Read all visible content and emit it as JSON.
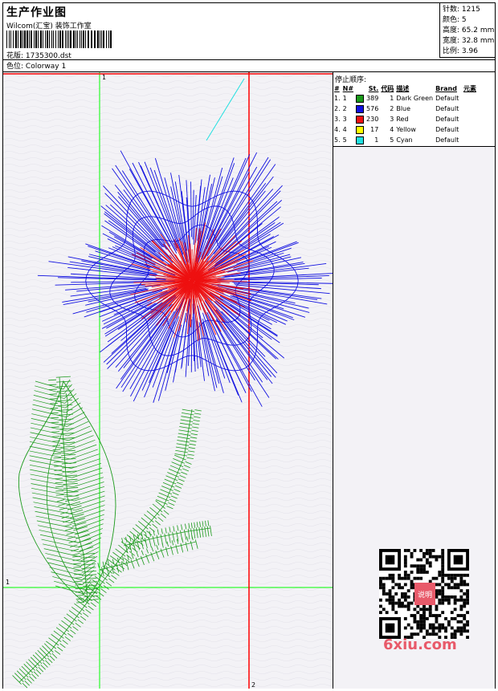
{
  "header": {
    "title": "生产作业图",
    "company": "Wilcom(汇宝) 装饰工作室",
    "design_label": "花版:",
    "design_value": "1735300.dst",
    "colorway_label": "色位:",
    "colorway_value": "Colorway 1"
  },
  "stats": {
    "stitches_label": "针数:",
    "stitches_value": "1215",
    "colors_label": "颜色:",
    "colors_value": "5",
    "height_label": "高度:",
    "height_value": "65.2 mm",
    "width_label": "宽度:",
    "width_value": "32.8 mm",
    "ratio_label": "比例:",
    "ratio_value": "3.96"
  },
  "stop_sequence": {
    "title": "停止顺序:",
    "headers": {
      "stop": "#",
      "needle": "N#",
      "stitches": "St.",
      "code": "代码",
      "description": "描述",
      "brand": "Brand",
      "element": "元素"
    },
    "rows": [
      {
        "stop": "1.",
        "needle": "1",
        "color": "#1a9a1a",
        "stitches": "389",
        "code": "1",
        "description": "Dark Green",
        "brand": "Default"
      },
      {
        "stop": "2.",
        "needle": "2",
        "color": "#1010e0",
        "stitches": "576",
        "code": "2",
        "description": "Blue",
        "brand": "Default"
      },
      {
        "stop": "3.",
        "needle": "3",
        "color": "#ee1010",
        "stitches": "230",
        "code": "3",
        "description": "Red",
        "brand": "Default"
      },
      {
        "stop": "4.",
        "needle": "4",
        "color": "#ffff00",
        "stitches": "17",
        "code": "4",
        "description": "Yellow",
        "brand": "Default"
      },
      {
        "stop": "5.",
        "needle": "5",
        "color": "#20e0e0",
        "stitches": "1",
        "code": "5",
        "description": "Cyan",
        "brand": "Default"
      }
    ]
  },
  "canvas": {
    "guide_top_label": "1",
    "guide_left_label": "1",
    "guide_bottom_label": "2"
  },
  "watermark": {
    "text": "6xiu.com",
    "qr_center_text": "说明"
  },
  "colors": {
    "green": "#1a9a1a",
    "blue": "#1010e0",
    "red": "#ee1010",
    "cyan": "#20e0e0",
    "guide_green": "#00ff00",
    "guide_red": "#ff0000"
  }
}
